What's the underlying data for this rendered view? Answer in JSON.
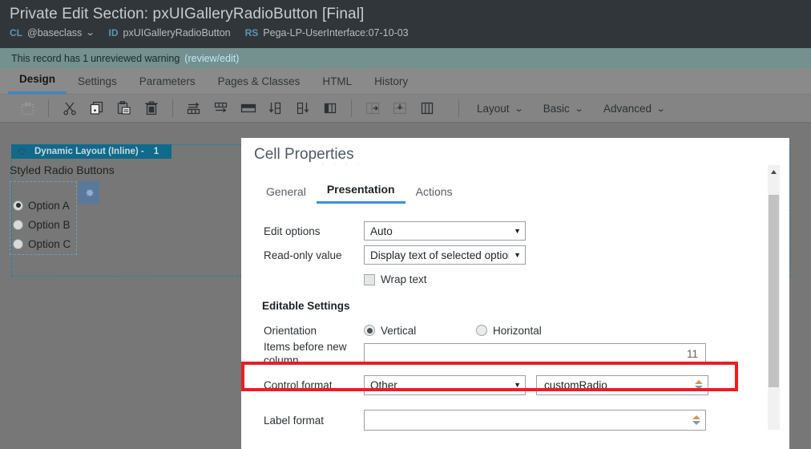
{
  "header": {
    "title": "Private Edit Section: pxUIGalleryRadioButton [Final]",
    "meta": [
      {
        "key": "CL",
        "value": "@baseclass",
        "caret": "⌄"
      },
      {
        "key": "ID",
        "value": "pxUIGalleryRadioButton"
      },
      {
        "key": "RS",
        "value": "Pega-LP-UserInterface:07-10-03"
      }
    ]
  },
  "warning": {
    "prefix": "This record has",
    "count": "1",
    "suffix": "unreviewed warning",
    "link": "(review/edit)"
  },
  "tabs": [
    {
      "label": "Design",
      "active": true
    },
    {
      "label": "Settings",
      "active": false
    },
    {
      "label": "Parameters",
      "active": false
    },
    {
      "label": "Pages & Classes",
      "active": false
    },
    {
      "label": "HTML",
      "active": false
    },
    {
      "label": "History",
      "active": false
    }
  ],
  "toolbar": {
    "icons": [
      {
        "name": "paste-placeholder-icon"
      },
      {
        "name": "cut-icon"
      },
      {
        "name": "copy-icon"
      },
      {
        "name": "paste-icon"
      },
      {
        "name": "delete-icon"
      },
      {
        "name": "insert-row-after-icon"
      },
      {
        "name": "insert-column-after-icon"
      },
      {
        "name": "merge-cells-icon"
      },
      {
        "name": "move-row-down-icon"
      },
      {
        "name": "move-column-down-icon"
      },
      {
        "name": "split-cell-icon"
      },
      {
        "name": "insert-right-icon"
      },
      {
        "name": "insert-below-icon"
      },
      {
        "name": "columns-icon"
      }
    ],
    "menus": [
      {
        "label": "Layout",
        "caret": "⌄"
      },
      {
        "label": "Basic",
        "caret": "⌄"
      },
      {
        "label": "Advanced",
        "caret": "⌄"
      }
    ]
  },
  "canvas": {
    "layout_header": {
      "title": "Dynamic Layout (Inline) -",
      "number": "1"
    },
    "section_label": "Styled Radio Buttons",
    "radio_group": [
      {
        "label": "Option A",
        "selected": true
      },
      {
        "label": "Option B",
        "selected": false
      },
      {
        "label": "Option C",
        "selected": false
      }
    ],
    "gear_badge": "gear-icon"
  },
  "dialog": {
    "title": "Cell Properties",
    "tabs": [
      {
        "label": "General",
        "active": false
      },
      {
        "label": "Presentation",
        "active": true
      },
      {
        "label": "Actions",
        "active": false
      }
    ],
    "fields": {
      "edit_options_label": "Edit options",
      "edit_options_value": "Auto",
      "read_only_label": "Read-only value",
      "read_only_value": "Display text of selected option",
      "wrap_text_label": "Wrap text",
      "wrap_text_checked": false,
      "editable_settings_heading": "Editable Settings",
      "orientation_label": "Orientation",
      "orientation_options": [
        {
          "label": "Vertical",
          "selected": true
        },
        {
          "label": "Horizontal",
          "selected": false
        }
      ],
      "items_before_label": "Items before new column",
      "items_before_value": "11",
      "control_format_label": "Control format",
      "control_format_value": "Other",
      "control_format_custom": "customRadio",
      "label_format_label": "Label format",
      "label_format_value": ""
    }
  },
  "colors": {
    "header_bg": "#31363b",
    "warning_bg": "#74908f",
    "tab_bg": "#8a8a8a",
    "canvas_bg": "#777777",
    "accent_blue": "#3d90d6",
    "teal": "#0f6a8b",
    "highlight_red": "#ee1c25",
    "spinner_up": "#d8935c",
    "spinner_down": "#7d9bad"
  }
}
